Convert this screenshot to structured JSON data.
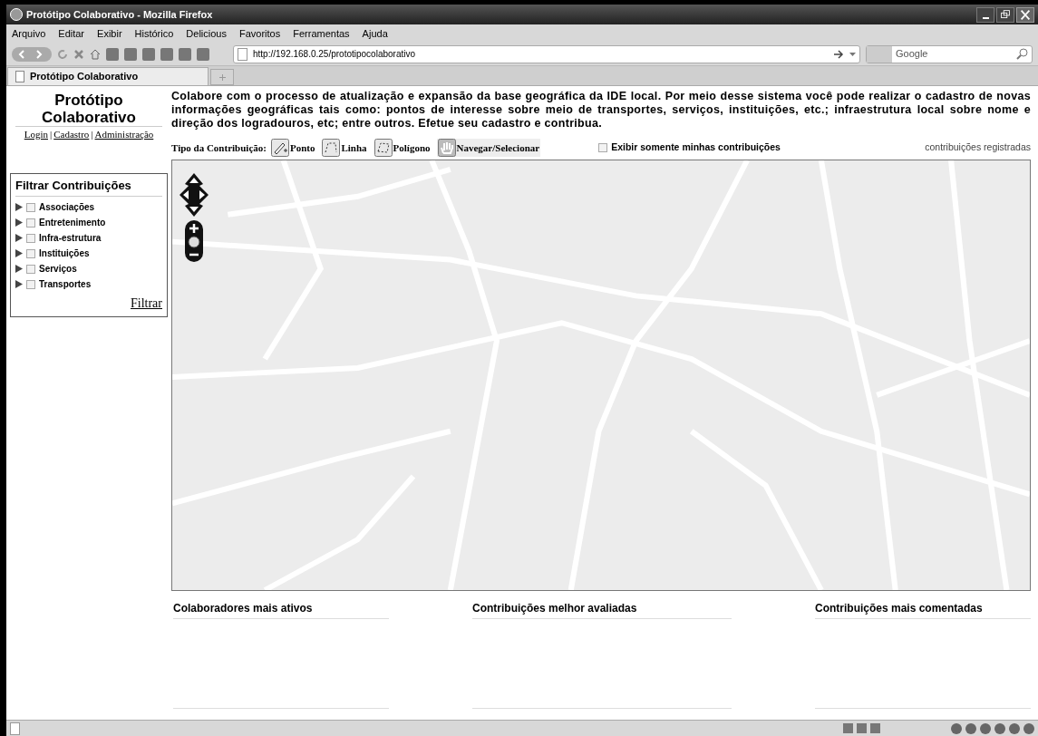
{
  "window": {
    "title": "Protótipo Colaborativo - Mozilla Firefox"
  },
  "menu": [
    "Arquivo",
    "Editar",
    "Exibir",
    "Histórico",
    "Delicious",
    "Favoritos",
    "Ferramentas",
    "Ajuda"
  ],
  "address": {
    "value": "http://192.168.0.25/prototipocolaborativo"
  },
  "search": {
    "placeholder": "Google"
  },
  "tabs": [
    {
      "label": "Protótipo Colaborativo",
      "selected": true
    }
  ],
  "site": {
    "title": "Protótipo Colaborativo",
    "links": [
      "Login",
      "Cadastro",
      "Administração"
    ],
    "separator": "|"
  },
  "intro": "Colabore com o processo de atualização e expansão da base geográfica da IDE local.  Por meio desse sistema você pode realizar o cadastro de novas informações geográficas tais como: pontos de  interesse sobre meio de  transportes, serviços, instituições, etc.;  infraestrutura local sobre nome e direção dos logradouros, etc; entre outros. Efetue seu cadastro e contribua.",
  "filter": {
    "title": "Filtrar Contribuições",
    "items": [
      {
        "label": "Associações",
        "checked": false,
        "expanded": false
      },
      {
        "label": "Entretenimento",
        "checked": false,
        "expanded": false
      },
      {
        "label": "Infra-estrutura",
        "checked": false,
        "expanded": false
      },
      {
        "label": "Instituições",
        "checked": false,
        "expanded": false
      },
      {
        "label": "Serviços",
        "checked": false,
        "expanded": false
      },
      {
        "label": "Transportes",
        "checked": false,
        "expanded": false
      }
    ],
    "button": "Filtrar"
  },
  "toolbar": {
    "label": "Tipo da Contribuição:",
    "tools": [
      {
        "kind": "point",
        "label": "Ponto",
        "selected": false
      },
      {
        "kind": "line",
        "label": "Linha",
        "selected": false
      },
      {
        "kind": "polygon",
        "label": "Polígono",
        "selected": false
      },
      {
        "kind": "pan",
        "label": "Navegar/Selecionar",
        "selected": true
      }
    ],
    "only_mine": {
      "label": "Exibir somente minhas contribuições",
      "checked": false
    },
    "registered": "contribuições registradas"
  },
  "panels": [
    "Colaboradores mais ativos",
    "Contribuições melhor avaliadas",
    "Contribuições mais comentadas"
  ]
}
